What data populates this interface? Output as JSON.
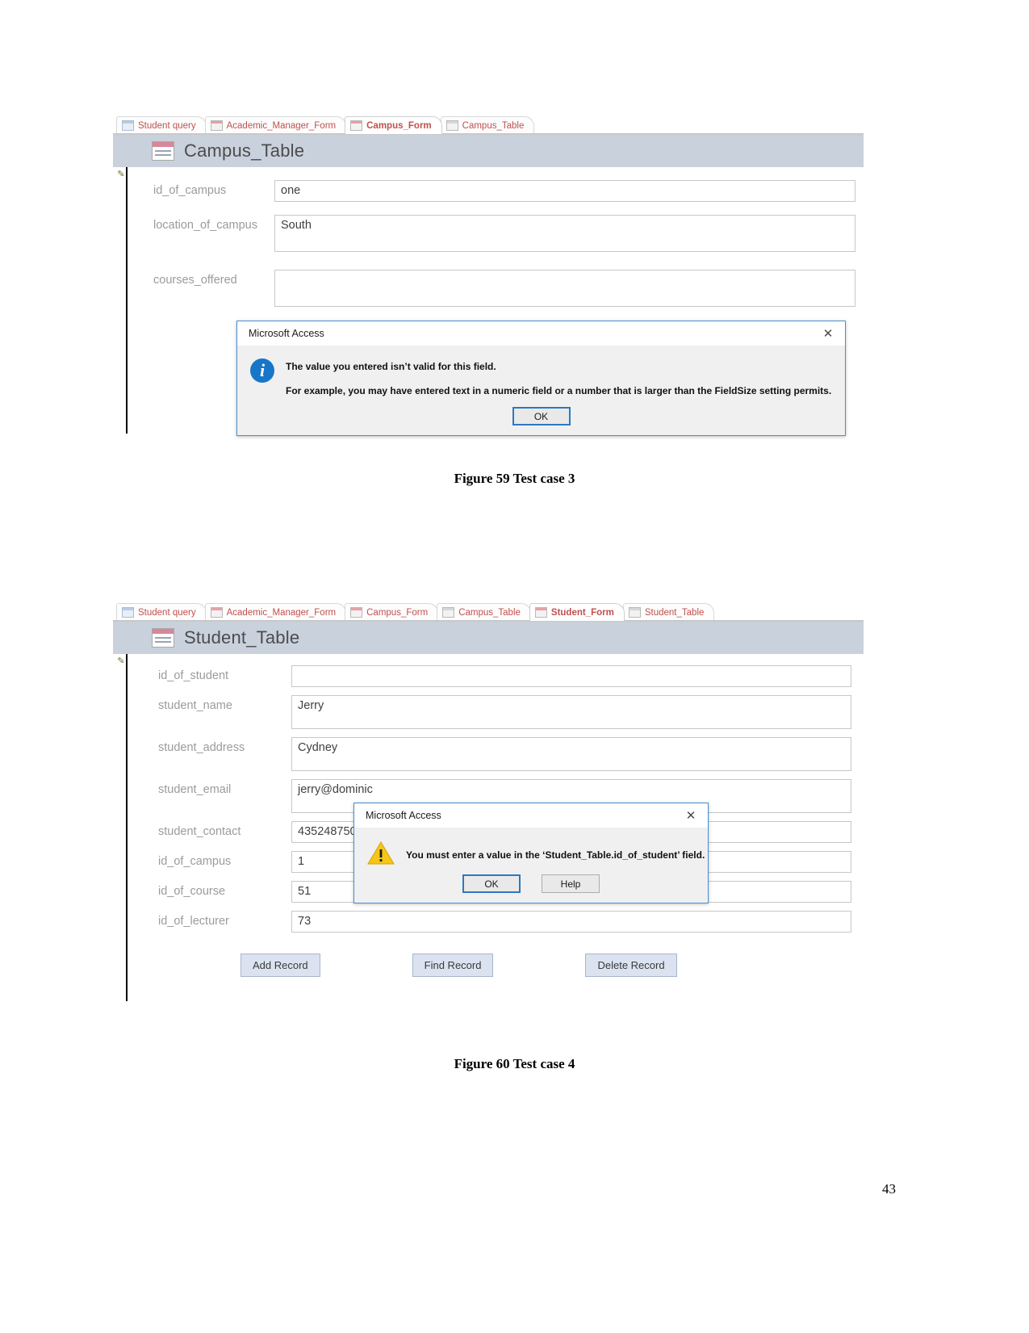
{
  "page": {
    "number": "43"
  },
  "figure1": {
    "caption": "Figure 59 Test case 3",
    "tabs": [
      {
        "label": "Student query",
        "type": "query",
        "active": false
      },
      {
        "label": "Academic_Manager_Form",
        "type": "form",
        "active": false
      },
      {
        "label": "Campus_Form",
        "type": "form",
        "active": true
      },
      {
        "label": "Campus_Table",
        "type": "table",
        "active": false
      }
    ],
    "title": "Campus_Table",
    "fields": [
      {
        "label": "id_of_campus",
        "value": "one"
      },
      {
        "label": "location_of_campus",
        "value": "South"
      },
      {
        "label": "courses_offered",
        "value": ""
      }
    ],
    "dialog": {
      "title": "Microsoft Access",
      "close": "✕",
      "icon": "info-icon",
      "message_primary": "The value you entered isn’t valid for this field.",
      "message_secondary": "For example, you may have entered text in a numeric field or a number that is larger than the FieldSize setting permits.",
      "buttons": [
        {
          "label": "OK",
          "default": true
        }
      ]
    }
  },
  "figure2": {
    "caption": "Figure 60 Test case 4",
    "tabs": [
      {
        "label": "Student query",
        "type": "query",
        "active": false
      },
      {
        "label": "Academic_Manager_Form",
        "type": "form",
        "active": false
      },
      {
        "label": "Campus_Form",
        "type": "form",
        "active": false
      },
      {
        "label": "Campus_Table",
        "type": "table",
        "active": false
      },
      {
        "label": "Student_Form",
        "type": "form",
        "active": true
      },
      {
        "label": "Student_Table",
        "type": "table",
        "active": false
      }
    ],
    "title": "Student_Table",
    "fields": [
      {
        "label": "id_of_student",
        "value": ""
      },
      {
        "label": "student_name",
        "value": "Jerry"
      },
      {
        "label": "student_address",
        "value": "Cydney"
      },
      {
        "label": "student_email",
        "value": "jerry@dominic"
      },
      {
        "label": "student_contact",
        "value": "435248750"
      },
      {
        "label": "id_of_campus",
        "value": "1"
      },
      {
        "label": "id_of_course",
        "value": "51"
      },
      {
        "label": "id_of_lecturer",
        "value": "73"
      }
    ],
    "record_buttons": [
      {
        "label": "Add Record"
      },
      {
        "label": "Find Record"
      },
      {
        "label": "Delete Record"
      }
    ],
    "dialog": {
      "title": "Microsoft Access",
      "close": "✕",
      "icon": "warning-icon",
      "message_primary": "You must enter a value in the ‘Student_Table.id_of_student’ field.",
      "buttons": [
        {
          "label": "OK",
          "default": true
        },
        {
          "label": "Help",
          "default": false
        }
      ]
    }
  },
  "colors": {
    "tab_text": "#c0504d",
    "title_bar": "#c9d1dc",
    "dialog_border": "#4a8fd0",
    "info_blue": "#1876c8",
    "warning_yellow": "#f5c518",
    "button_blue": "#dbe3f0"
  }
}
